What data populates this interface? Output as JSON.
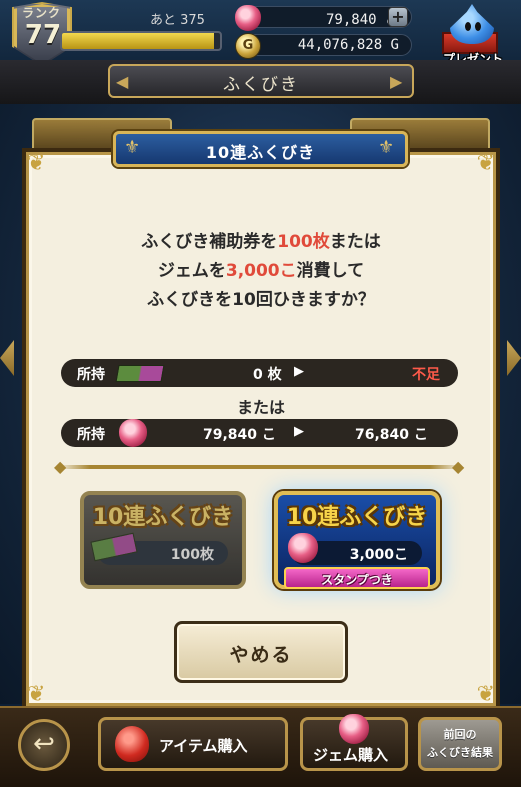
{
  "header": {
    "rank_label": "ランク",
    "rank_value": "77",
    "exp_label": "あと 375",
    "exp_progress": 0.96,
    "gems_value": "79,840 こ",
    "gold_value": "44,076,828 G",
    "gold_symbol": "G",
    "plus_label": "+",
    "present_label": "プレゼント"
  },
  "subtitle": {
    "label": "ふくびき"
  },
  "modal": {
    "title": "10連ふくびき",
    "message": {
      "line1_a": "ふくびき補助券を",
      "line1_red": "100枚",
      "line1_b": "または",
      "line2_a": "ジェムを",
      "line2_red": "3,000こ",
      "line2_b": "消費して",
      "line3": "ふくびきを10回ひきますか？"
    },
    "ticket_row": {
      "label": "所持",
      "amount": "0 枚",
      "arrow": "▶",
      "status": "不足"
    },
    "or_text": "または",
    "gem_row": {
      "label": "所持",
      "amount": "79,840 こ",
      "arrow": "▶",
      "after": "76,840 こ"
    },
    "ticket_button": {
      "title": "10連ふくびき",
      "cost": "100枚"
    },
    "gem_button": {
      "title": "10連ふくびき",
      "cost": "3,000こ",
      "ribbon": "スタンプつき"
    },
    "cancel_label": "やめる"
  },
  "bottom": {
    "back_icon": "↩",
    "item_shop_label": "アイテム購入",
    "gem_shop_label": "ジェム購入",
    "history_line1": "前回の",
    "history_line2": "ふくびき結果"
  },
  "colors": {
    "accent_red": "#e04a3a",
    "gold_border": "#b89648",
    "title_blue": "#2c5ea0"
  }
}
